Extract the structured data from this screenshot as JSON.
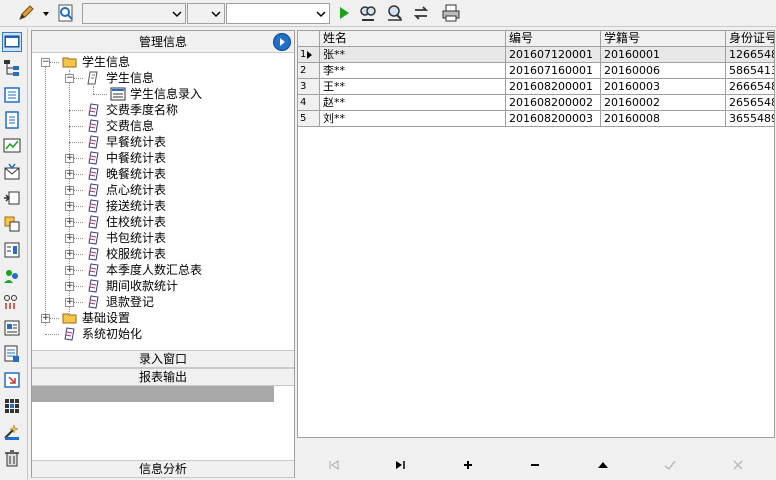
{
  "toolbar": {
    "combo3_value": "",
    "icons": [
      "pencil-icon",
      "dropdown-arrow-icon",
      "preview-icon",
      "run-icon",
      "find-icon",
      "find-next-icon",
      "refresh-icon",
      "print-icon"
    ]
  },
  "sidebar": {
    "icons": [
      "window-icon",
      "tree-icon",
      "list-icon",
      "document-icon",
      "chart-icon",
      "envelope-icon",
      "module-icon",
      "copy-icon",
      "properties-icon",
      "users-icon",
      "dots-icon",
      "report-icon",
      "report2-icon",
      "export-icon",
      "grid-icon",
      "wizard-icon",
      "trash-icon"
    ]
  },
  "nav_panel": {
    "title": "管理信息",
    "tree": [
      {
        "label": "学生信息",
        "icon": "folder-open-icon"
      },
      {
        "label": "学生信息",
        "icon": "report-icon"
      },
      {
        "label": "学生信息录入",
        "icon": "form-icon"
      },
      {
        "label": "交费季度名称",
        "icon": "report-icon"
      },
      {
        "label": "交费信息",
        "icon": "report-icon"
      },
      {
        "label": "早餐统计表",
        "icon": "report-icon"
      },
      {
        "label": "中餐统计表",
        "icon": "report-icon"
      },
      {
        "label": "晚餐统计表",
        "icon": "report-icon"
      },
      {
        "label": "点心统计表",
        "icon": "report-icon"
      },
      {
        "label": "接送统计表",
        "icon": "report-icon"
      },
      {
        "label": "住校统计表",
        "icon": "report-icon"
      },
      {
        "label": "书包统计表",
        "icon": "report-icon"
      },
      {
        "label": "校服统计表",
        "icon": "report-icon"
      },
      {
        "label": "本季度人数汇总表",
        "icon": "report-icon"
      },
      {
        "label": "期间收款统计",
        "icon": "report-icon"
      },
      {
        "label": "退款登记",
        "icon": "report-icon"
      },
      {
        "label": "基础设置",
        "icon": "folder-icon"
      },
      {
        "label": "系统初始化",
        "icon": "report-icon"
      }
    ],
    "bars": {
      "entry_window": "录入窗口",
      "report_output": "报表输出",
      "info_analysis": "信息分析"
    }
  },
  "grid": {
    "columns": [
      "姓名",
      "编号",
      "学籍号",
      "身份证号"
    ],
    "rows": [
      {
        "num": "1",
        "name": "张**",
        "code": "201607120001",
        "student_no": "20160001",
        "id_card": "1266548"
      },
      {
        "num": "2",
        "name": "李**",
        "code": "201607160001",
        "student_no": "20160006",
        "id_card": "5865413"
      },
      {
        "num": "3",
        "name": "王**",
        "code": "201608200001",
        "student_no": "20160003",
        "id_card": "2666548"
      },
      {
        "num": "4",
        "name": "赵**",
        "code": "201608200002",
        "student_no": "20160002",
        "id_card": "2656548"
      },
      {
        "num": "5",
        "name": "刘**",
        "code": "201608200003",
        "student_no": "20160008",
        "id_card": "3655489"
      }
    ],
    "selected_row": 1
  },
  "navigator": {
    "buttons": [
      {
        "name": "first-record-button",
        "glyph": "|◀"
      },
      {
        "name": "last-record-button",
        "glyph": "▶|"
      },
      {
        "name": "insert-record-button",
        "glyph": "+"
      },
      {
        "name": "delete-record-button",
        "glyph": "−"
      },
      {
        "name": "edit-record-button",
        "glyph": "▲"
      },
      {
        "name": "post-record-button",
        "glyph": "✓"
      },
      {
        "name": "cancel-record-button",
        "glyph": "✕"
      }
    ]
  },
  "colors": {
    "accent_blue": "#1f6fc7",
    "folder_yellow": "#f3c64a",
    "run_green": "#1aa31a",
    "selected_bar": "#a9a9a9"
  }
}
